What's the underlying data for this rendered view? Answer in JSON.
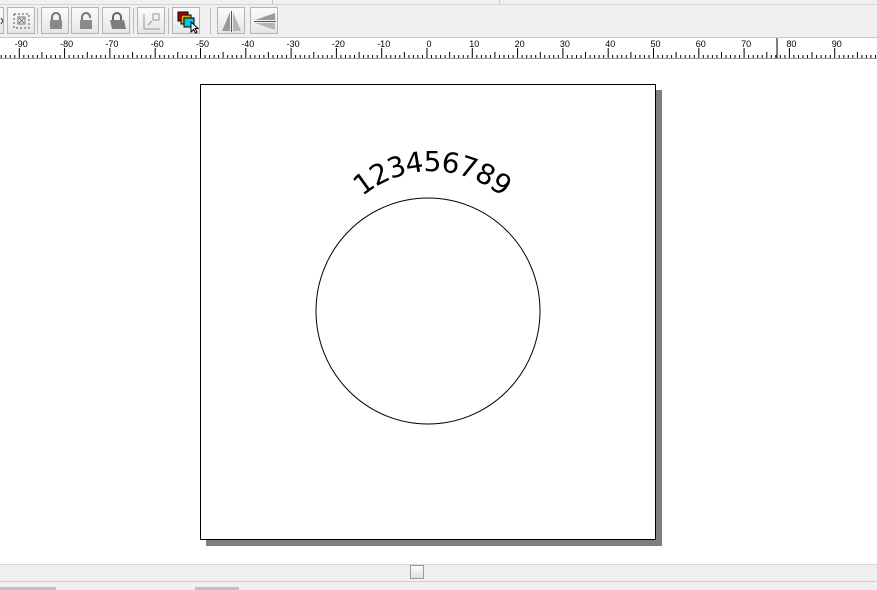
{
  "toolbar": {
    "buttons": [
      {
        "name": "group-button",
        "icon": "group-icon"
      },
      {
        "name": "lock-button",
        "icon": "lock-icon"
      },
      {
        "name": "unlock-button",
        "icon": "unlock-icon"
      },
      {
        "name": "lock-all-button",
        "icon": "lock-all-icon"
      },
      {
        "name": "origin-button",
        "icon": "origin-icon"
      },
      {
        "name": "layer-order-button",
        "icon": "layers-icon"
      },
      {
        "name": "mirror-horizontal-button",
        "icon": "mirror-horizontal-icon"
      },
      {
        "name": "mirror-vertical-button",
        "icon": "mirror-vertical-icon"
      }
    ]
  },
  "ruler": {
    "labels": [
      "-90",
      "-80",
      "-70",
      "-60",
      "-50",
      "-40",
      "-30",
      "-20",
      "-10",
      "0",
      "10",
      "20",
      "30",
      "40",
      "50",
      "60",
      "70",
      "80",
      "90"
    ]
  },
  "canvas": {
    "arc_text": "123456789",
    "colors": {
      "page": "#ffffff",
      "shadow": "#7f7f7f",
      "ink": "#000000"
    }
  }
}
